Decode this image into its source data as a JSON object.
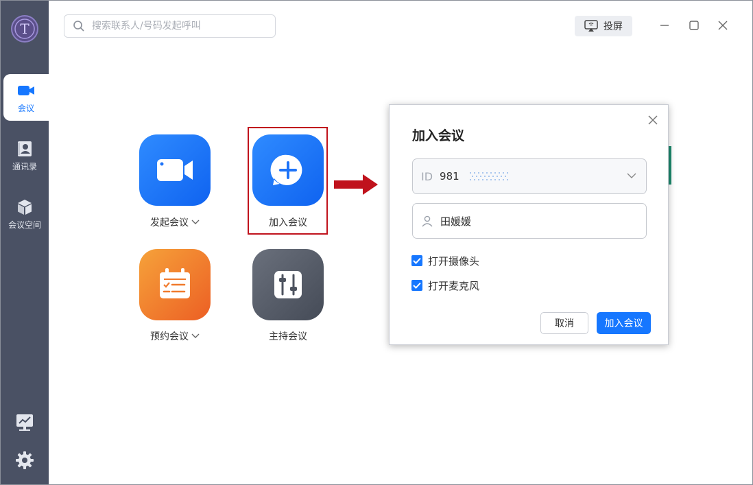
{
  "sidebar": {
    "items": [
      {
        "label": "会议",
        "icon": "video-camera-icon",
        "active": true
      },
      {
        "label": "通讯录",
        "icon": "contacts-icon",
        "active": false
      },
      {
        "label": "会议空间",
        "icon": "cube-icon",
        "active": false
      }
    ],
    "bottom_icons": [
      "monitor-chart-icon",
      "gear-icon"
    ]
  },
  "topbar": {
    "search_placeholder": "搜索联系人/号码发起呼叫",
    "cast_label": "投屏"
  },
  "actions": {
    "start_meeting": "发起会议",
    "join_meeting": "加入会议",
    "schedule_meeting": "预约会议",
    "host_meeting": "主持会议"
  },
  "dialog": {
    "title": "加入会议",
    "id_prefix": "ID",
    "id_value": "981",
    "name_value": "田媛媛",
    "checkbox_camera": "打开摄像头",
    "checkbox_mic": "打开麦克风",
    "camera_checked": true,
    "mic_checked": true,
    "cancel_label": "取消",
    "join_label": "加入会议"
  },
  "colors": {
    "sidebar_bg": "#4a5164",
    "accent_blue": "#1677ff",
    "tile_orange": "#f07a2c",
    "tile_gray": "#565c69",
    "highlight_red": "#c0121c"
  }
}
